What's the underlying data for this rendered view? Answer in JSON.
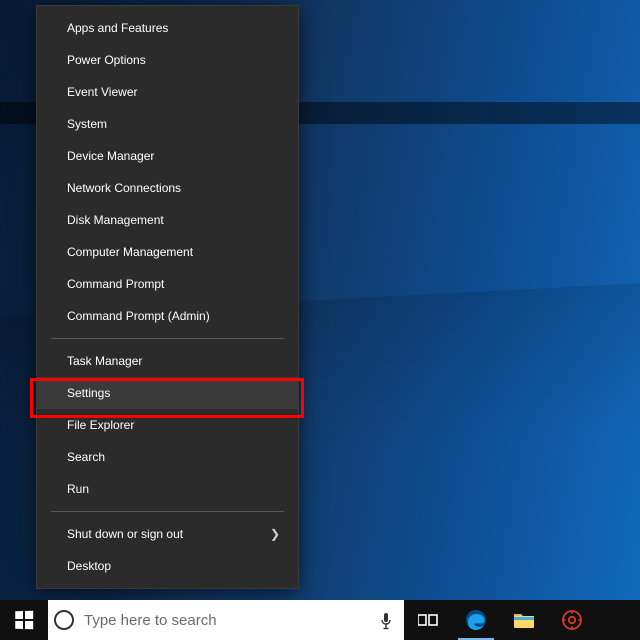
{
  "menu": {
    "group1": [
      "Apps and Features",
      "Power Options",
      "Event Viewer",
      "System",
      "Device Manager",
      "Network Connections",
      "Disk Management",
      "Computer Management",
      "Command Prompt",
      "Command Prompt (Admin)"
    ],
    "group2": [
      "Task Manager",
      "Settings",
      "File Explorer",
      "Search",
      "Run"
    ],
    "group3": [
      {
        "label": "Shut down or sign out",
        "submenu": true
      },
      {
        "label": "Desktop",
        "submenu": false
      }
    ],
    "highlighted": "Settings"
  },
  "taskbar": {
    "search_placeholder": "Type here to search"
  }
}
